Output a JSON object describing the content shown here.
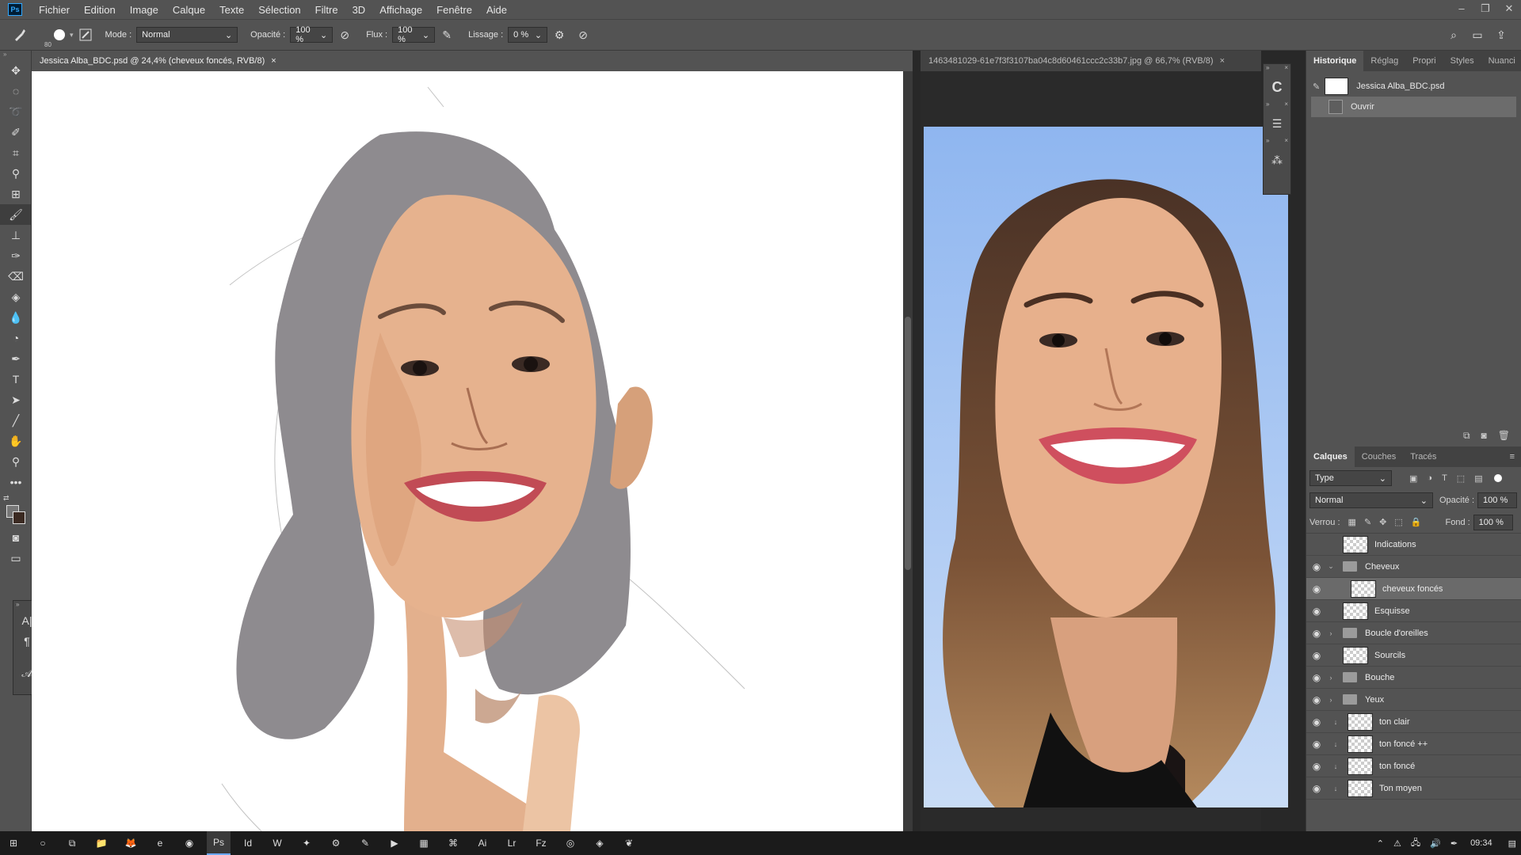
{
  "app": {
    "logo": "Ps",
    "window_controls": {
      "minimize": "–",
      "restore": "❐",
      "close": "✕"
    }
  },
  "menu": [
    "Fichier",
    "Edition",
    "Image",
    "Calque",
    "Texte",
    "Sélection",
    "Filtre",
    "3D",
    "Affichage",
    "Fenêtre",
    "Aide"
  ],
  "options": {
    "brush_size": "80",
    "mode_label": "Mode :",
    "mode_value": "Normal",
    "opacity_label": "Opacité :",
    "opacity_value": "100 %",
    "flux_label": "Flux :",
    "flux_value": "100 %",
    "lissage_label": "Lissage :",
    "lissage_value": "0 %"
  },
  "documents": {
    "active_tab": "Jessica Alba_BDC.psd @ 24,4% (cheveux foncés, RVB/8)",
    "secondary_tab": "1463481029-61e7f3f3107ba04c8d60461ccc2c33b7.jpg @ 66,7% (RVB/8)",
    "close_glyph": "×"
  },
  "history_panel": {
    "tabs": [
      "Historique",
      "Réglag",
      "Propri",
      "Styles",
      "Nuanci"
    ],
    "snapshot": "Jessica Alba_BDC.psd",
    "steps": [
      "Ouvrir"
    ]
  },
  "layers_panel": {
    "tabs": [
      "Calques",
      "Couches",
      "Tracés"
    ],
    "filter_label": "Type",
    "blend_mode": "Normal",
    "opacity_label": "Opacité :",
    "opacity_value": "100 %",
    "lock_label": "Verrou :",
    "fill_label": "Fond :",
    "fill_value": "100 %",
    "layers": [
      {
        "name": "Indications",
        "kind": "layer",
        "visible": false
      },
      {
        "name": "Cheveux",
        "kind": "group-open",
        "visible": true
      },
      {
        "name": "cheveux foncés",
        "kind": "layer-indent",
        "visible": true
      },
      {
        "name": "Esquisse",
        "kind": "layer",
        "visible": true
      },
      {
        "name": "Boucle d'oreilles",
        "kind": "group",
        "visible": true
      },
      {
        "name": "Sourcils",
        "kind": "layer",
        "visible": true
      },
      {
        "name": "Bouche",
        "kind": "group",
        "visible": true
      },
      {
        "name": "Yeux",
        "kind": "group",
        "visible": true
      },
      {
        "name": "ton clair",
        "kind": "clip",
        "visible": true
      },
      {
        "name": "ton foncé ++",
        "kind": "clip",
        "visible": true
      },
      {
        "name": "ton foncé",
        "kind": "clip",
        "visible": true
      },
      {
        "name": "Ton moyen",
        "kind": "clip",
        "visible": true
      }
    ]
  },
  "taskbar": {
    "time": "09:34",
    "icons": [
      "windows-icon",
      "cortana-icon",
      "taskview-icon",
      "explorer-icon",
      "firefox-icon",
      "edge-icon",
      "chrome-icon",
      "photoshop-icon",
      "indesign-icon",
      "word-icon",
      "app-icon",
      "app2-icon",
      "app3-icon",
      "app4-icon",
      "calculator-icon",
      "app5-icon",
      "illustrator-icon",
      "lightroom-icon",
      "filezilla-icon",
      "app6-icon",
      "app7-icon",
      "app8-icon"
    ],
    "icon_labels": [
      "⊞",
      "○",
      "⧉",
      "📁",
      "🦊",
      "e",
      "◉",
      "Ps",
      "Id",
      "W",
      "✦",
      "⚙",
      "✎",
      "▶",
      "▦",
      "⌘",
      "Ai",
      "Lr",
      "Fz",
      "◎",
      "◈",
      "❦"
    ]
  },
  "colors": {
    "accent_blue": "#31a8ff",
    "panel_bg": "#535353",
    "hair_gray": "#8e8b8f"
  }
}
